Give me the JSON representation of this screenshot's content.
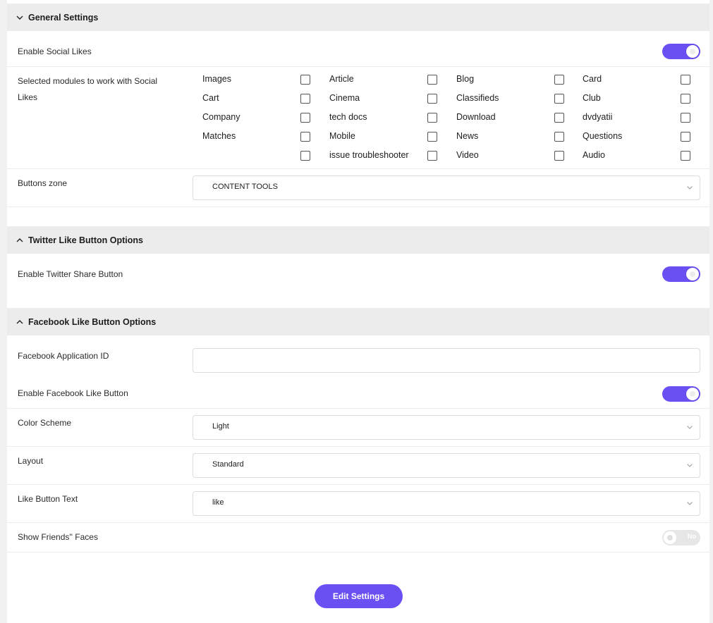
{
  "general": {
    "title": "General Settings",
    "enable_social_likes_label": "Enable Social Likes",
    "enable_social_likes": true,
    "modules_label": "Selected modules to work with Social Likes",
    "modules": [
      [
        "Images",
        "Article",
        "Blog",
        "Card"
      ],
      [
        "Cart",
        "Cinema",
        "Classifieds",
        "Club"
      ],
      [
        "Company",
        "tech docs",
        "Download",
        "dvdyatii"
      ],
      [
        "Matches",
        "Mobile",
        "News",
        "Questions"
      ],
      [
        "",
        "issue troubleshooter",
        "Video",
        "Audio"
      ]
    ],
    "buttons_zone_label": "Buttons zone",
    "buttons_zone_value": "CONTENT TOOLS"
  },
  "twitter": {
    "title": "Twitter Like Button Options",
    "enable_label": "Enable Twitter Share Button",
    "enabled": true
  },
  "facebook": {
    "title": "Facebook Like Button Options",
    "app_id_label": "Facebook Application ID",
    "app_id_value": "",
    "enable_label": "Enable Facebook Like Button",
    "enabled": true,
    "color_scheme_label": "Color Scheme",
    "color_scheme_value": "Light",
    "layout_label": "Layout",
    "layout_value": "Standard",
    "like_text_label": "Like Button Text",
    "like_text_value": "like",
    "show_faces_label": "Show Friends'' Faces",
    "show_faces": false,
    "show_faces_state_text": "No"
  },
  "actions": {
    "edit_settings_label": "Edit Settings"
  },
  "colors": {
    "accent": "#6a4ff2",
    "section_header_bg": "#ececec",
    "page_bg": "#f1f1f1"
  }
}
